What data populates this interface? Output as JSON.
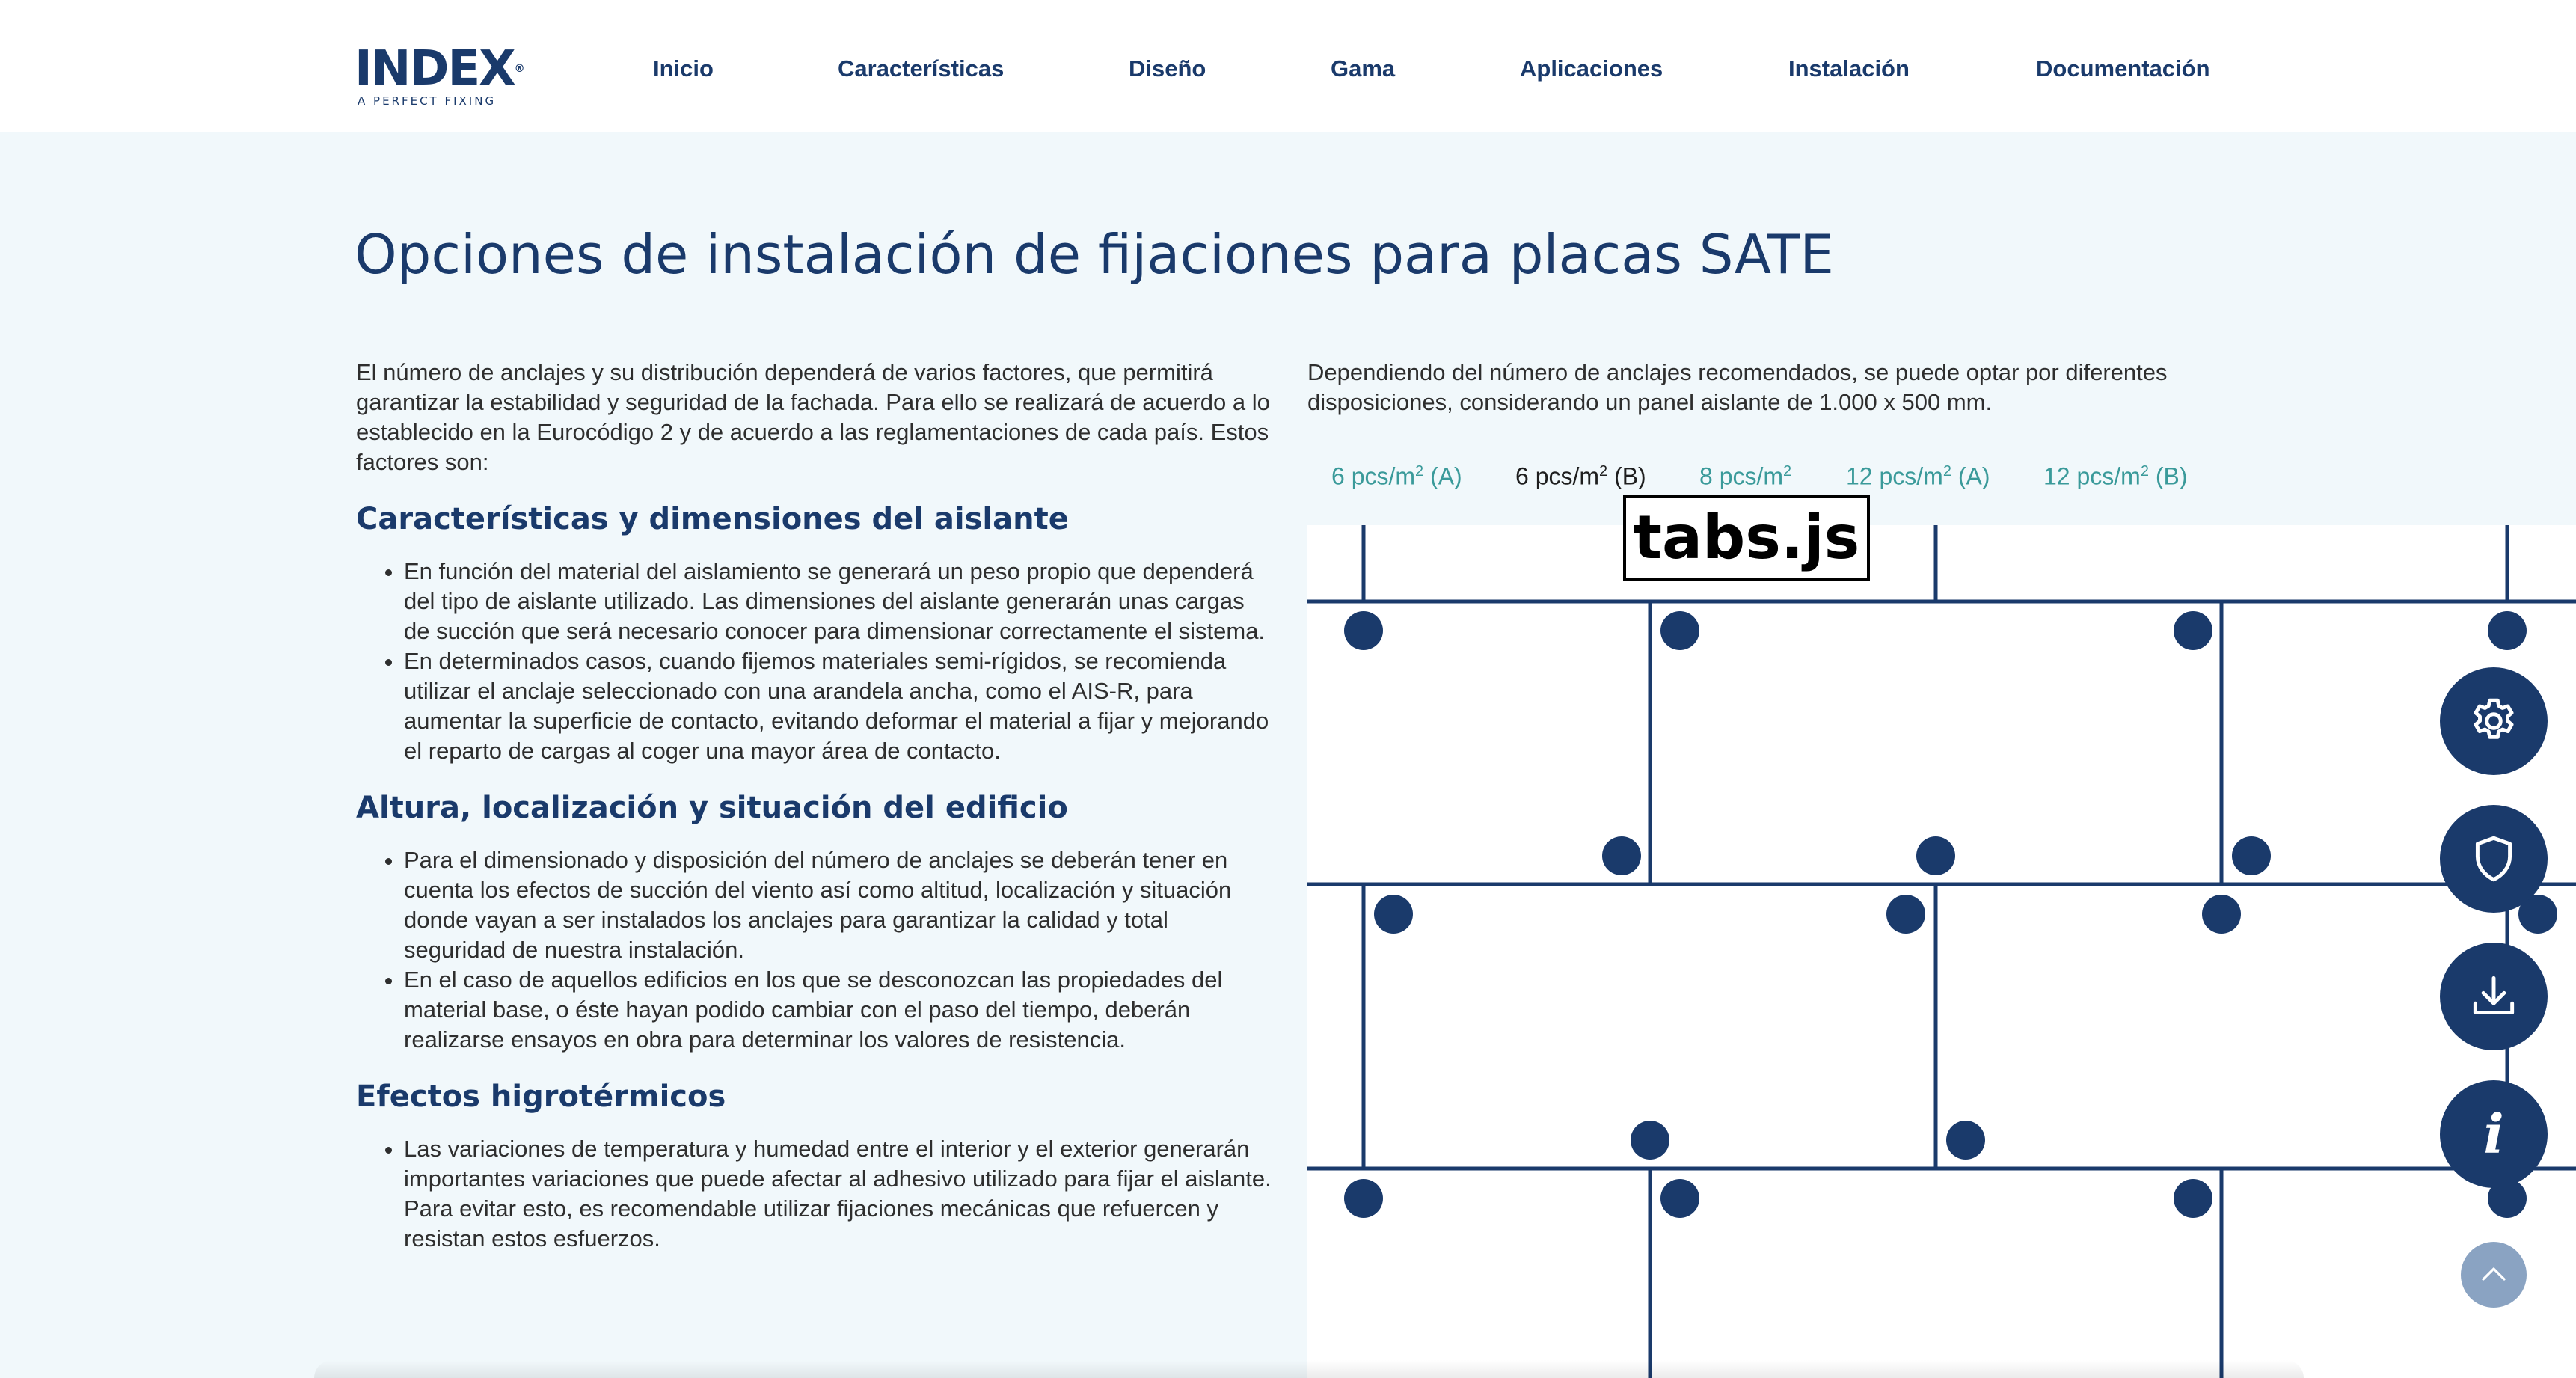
{
  "header": {
    "logo": {
      "brand": "INDEX",
      "mark": "®",
      "tagline": "A PERFECT FIXING"
    },
    "nav": [
      {
        "label": "Inicio"
      },
      {
        "label": "Características"
      },
      {
        "label": "Diseño"
      },
      {
        "label": "Gama"
      },
      {
        "label": "Aplicaciones"
      },
      {
        "label": "Instalación"
      },
      {
        "label": "Documentación"
      }
    ]
  },
  "main": {
    "title": "Opciones de instalación de fijaciones para placas SATE",
    "intro": "El número de anclajes y su distribución dependerá de varios factores, que permitirá garantizar la estabilidad y seguridad de la fachada. Para ello se realizará de acuerdo a lo establecido en la Eurocódigo 2 y de acuerdo a las reglamentaciones de cada país. Estos factores son:",
    "sections": [
      {
        "heading": "Características y dimensiones del aislante",
        "items": [
          "En función del material del aislamiento se generará un peso propio que dependerá del tipo de aislante utilizado. Las dimensiones del aislante generarán unas cargas de succión que será necesario conocer para dimensionar correctamente el sistema.",
          "En determinados casos, cuando fijemos materiales semi-rígidos, se recomienda utilizar el anclaje seleccionado con una arandela ancha, como el AIS-R, para aumentar la superficie de contacto, evitando deformar el material a fijar y mejorando el reparto de cargas al coger una mayor área de contacto."
        ]
      },
      {
        "heading": "Altura, localización y situación del edificio",
        "items": [
          "Para el dimensionado y disposición del número de anclajes se deberán tener en cuenta los efectos de succión del viento así como altitud, localización y situación donde vayan a ser instalados los anclajes para garantizar la calidad y total seguridad de nuestra instalación.",
          "En el caso de aquellos edificios en los que se desconozcan las propiedades del material base, o éste hayan podido cambiar con el paso del tiempo, deberán realizarse ensayos en obra para determinar los valores de resistencia."
        ]
      },
      {
        "heading": "Efectos higrotérmicos",
        "items": [
          "Las variaciones de temperatura y humedad entre el interior y el exterior generarán importantes variaciones que puede afectar al adhesivo utilizado para fijar el aislante. Para evitar esto, es recomendable utilizar fijaciones mecánicas que refuercen y resistan estos esfuerzos."
        ]
      }
    ],
    "right_intro": "Dependiendo del número de anclajes recomendados, se puede optar por diferentes disposiciones, considerando un panel aislante de 1.000 x 500 mm.",
    "tabs": [
      {
        "pre": "6 pcs/m",
        "sup": "2",
        "post": " (A)",
        "active": false
      },
      {
        "pre": "6 pcs/m",
        "sup": "2",
        "post": " (B)",
        "active": true
      },
      {
        "pre": "8 pcs/m",
        "sup": "2",
        "post": "",
        "active": false
      },
      {
        "pre": "12 pcs/m",
        "sup": "2",
        "post": " (A)",
        "active": false
      },
      {
        "pre": "12 pcs/m",
        "sup": "2",
        "post": " (B)",
        "active": false
      }
    ],
    "script_label": "tabs.js"
  },
  "floating": {
    "buttons": [
      {
        "icon": "gear-icon"
      },
      {
        "icon": "shield-icon"
      },
      {
        "icon": "download-icon"
      },
      {
        "icon": "info-icon",
        "glyph": "i"
      }
    ],
    "scroll_top_icon": "chevron-up-icon"
  },
  "colors": {
    "primary": "#1a3a6b",
    "tab_inactive": "#3a9a9a",
    "page_background": "#f1f8fb",
    "scroll_button": "#8aa3c2"
  }
}
